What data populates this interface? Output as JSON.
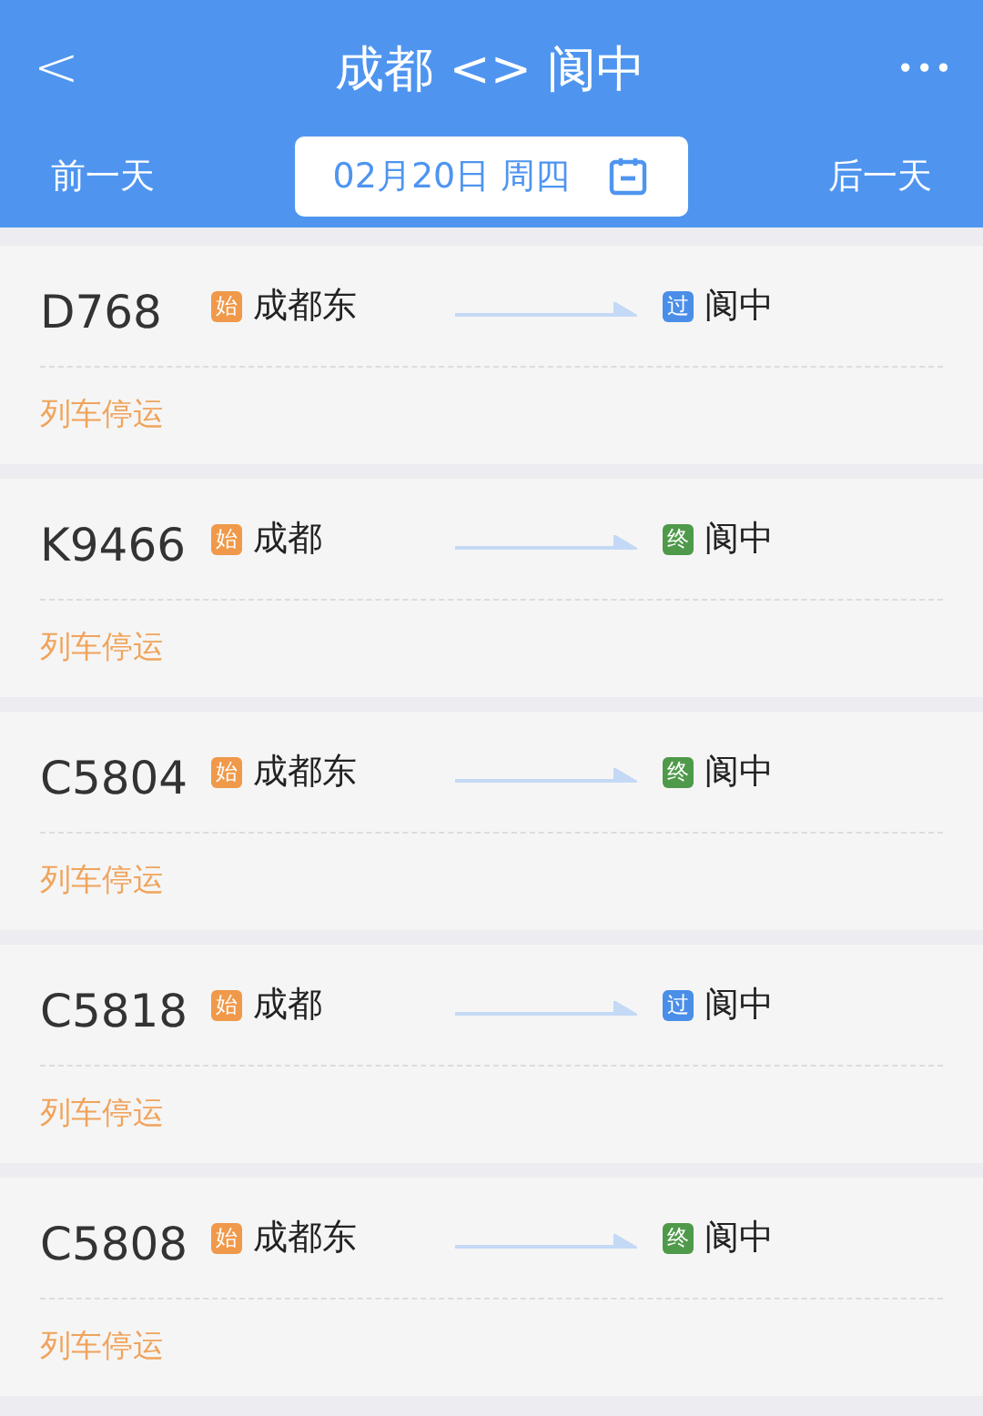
{
  "header": {
    "back": "<",
    "title": "成都 <> 阆中",
    "more": "•••"
  },
  "date_bar": {
    "prev": "前一天",
    "date": "02月20日 周四",
    "next": "后一天"
  },
  "trains": [
    {
      "number": "D768",
      "from_badge": {
        "text": "始",
        "color": "#f0994a"
      },
      "from": "成都东",
      "to_badge": {
        "text": "过",
        "color": "#4a8ee8"
      },
      "to": "阆中",
      "status": "列车停运"
    },
    {
      "number": "K9466",
      "from_badge": {
        "text": "始",
        "color": "#f0994a"
      },
      "from": "成都",
      "to_badge": {
        "text": "终",
        "color": "#4f9a4a"
      },
      "to": "阆中",
      "status": "列车停运"
    },
    {
      "number": "C5804",
      "from_badge": {
        "text": "始",
        "color": "#f0994a"
      },
      "from": "成都东",
      "to_badge": {
        "text": "终",
        "color": "#4f9a4a"
      },
      "to": "阆中",
      "status": "列车停运"
    },
    {
      "number": "C5818",
      "from_badge": {
        "text": "始",
        "color": "#f0994a"
      },
      "from": "成都",
      "to_badge": {
        "text": "过",
        "color": "#4a8ee8"
      },
      "to": "阆中",
      "status": "列车停运"
    },
    {
      "number": "C5808",
      "from_badge": {
        "text": "始",
        "color": "#f0994a"
      },
      "from": "成都东",
      "to_badge": {
        "text": "终",
        "color": "#4f9a4a"
      },
      "to": "阆中",
      "status": "列车停运"
    }
  ]
}
